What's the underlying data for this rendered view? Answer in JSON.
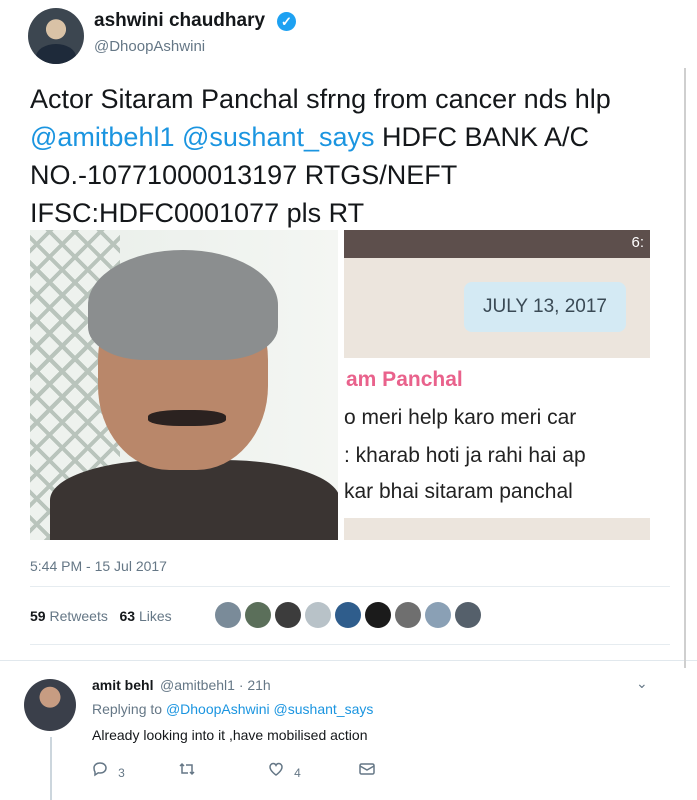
{
  "tweet": {
    "author": {
      "name": "ashwini chaudhary",
      "handle": "@DhoopAshwini"
    },
    "text": {
      "part1": "Actor Sitaram Panchal sfrng from cancer nds hlp ",
      "mention1": "@amitbehl1",
      "mention2": "@sushant_says",
      "part2": " HDFC BANK A/C NO.-10771000013197 RTGS/NEFT IFSC:HDFC0001077 pls RT"
    },
    "chat_screenshot": {
      "time": "6:",
      "date": "JULY 13, 2017",
      "sender": "am Panchal",
      "lines": [
        "o meri help karo meri car",
        ": kharab hoti ja rahi hai ap",
        "kar bhai sitaram panchal"
      ]
    },
    "timestamp": "5:44 PM - 15 Jul 2017",
    "stats": {
      "retweets_count": "59",
      "retweets_label": "Retweets",
      "likes_count": "63",
      "likes_label": "Likes"
    },
    "liker_colors": [
      "#7a8b99",
      "#5b6f5a",
      "#3c3c3c",
      "#b8c2c8",
      "#2f5d8c",
      "#1b1b1b",
      "#6f6f6f",
      "#8aa0b5",
      "#55606b"
    ]
  },
  "reply": {
    "name": "amit behl",
    "handle": "@amitbehl1",
    "age": "· 21h",
    "replying_prefix": "Replying to",
    "replying_to": "@DhoopAshwini @sushant_says",
    "text": "Already looking into it ,have mobilised action",
    "reply_count": "3",
    "like_count": "4"
  },
  "colors": {
    "link": "#1b95e0",
    "verified": "#1da1f2",
    "muted": "#657786"
  }
}
